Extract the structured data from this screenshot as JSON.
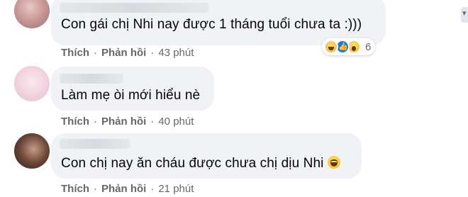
{
  "comments": [
    {
      "text": "Con gái chị Nhi nay được 1 tháng tuổi chưa ta :)))",
      "like": "Thích",
      "reply": "Phản hồi",
      "time": "43 phút",
      "reactions": {
        "icons": [
          "haha-icon",
          "like-icon",
          "wow-icon"
        ],
        "count": "6"
      }
    },
    {
      "text": "Làm mẹ òi mới hiểu nè",
      "like": "Thích",
      "reply": "Phản hồi",
      "time": "40 phút"
    },
    {
      "text": "Con chị nay ăn cháu được chưa chị dịu Nhi",
      "emoji": "laughing-emoji",
      "like": "Thích",
      "reply": "Phản hồi",
      "time": "21 phút"
    }
  ],
  "separator": "·",
  "colors": {
    "bubble": "#f0f2f5",
    "meta": "#65676b",
    "text": "#050505",
    "like_blue": "#1877f2"
  }
}
